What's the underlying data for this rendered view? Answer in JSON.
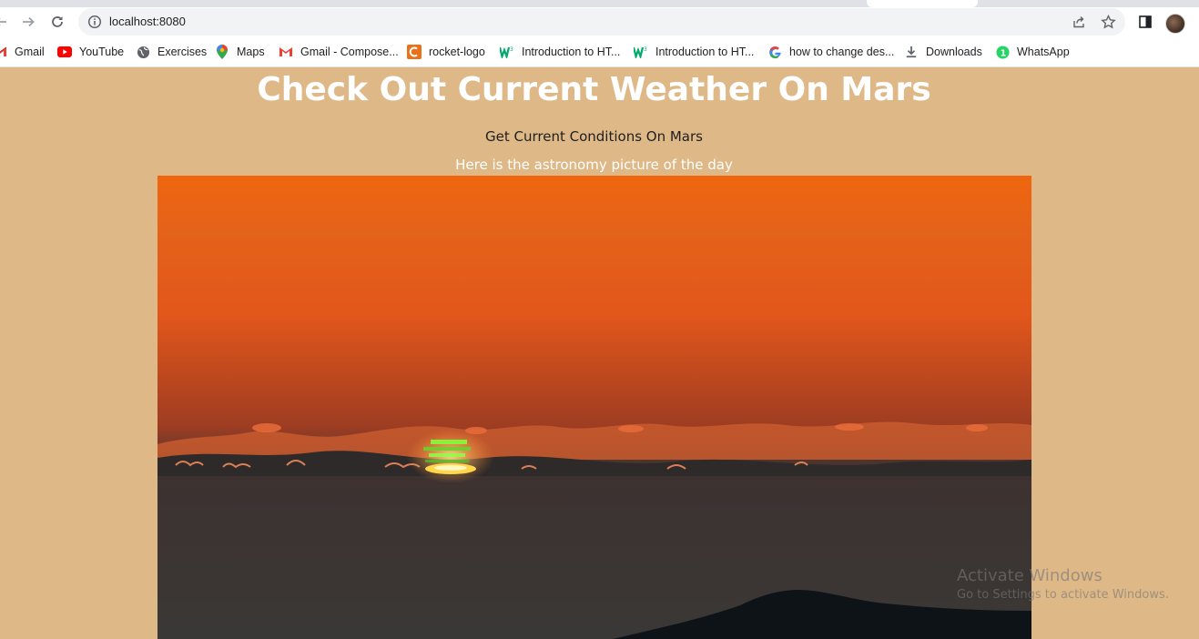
{
  "browser": {
    "url": "localhost:8080",
    "bookmarks": [
      {
        "label": "Gmail",
        "icon": "gmail-icon"
      },
      {
        "label": "YouTube",
        "icon": "youtube-icon"
      },
      {
        "label": "Exercises",
        "icon": "globe-icon"
      },
      {
        "label": "Maps",
        "icon": "maps-pin-icon"
      },
      {
        "label": "Gmail - Compose...",
        "icon": "gmail-icon"
      },
      {
        "label": "rocket-logo",
        "icon": "rocket-logo-icon"
      },
      {
        "label": "Introduction to HT...",
        "icon": "w3schools-icon"
      },
      {
        "label": "Introduction to HT...",
        "icon": "w3schools-icon"
      },
      {
        "label": "how to change des...",
        "icon": "google-icon"
      },
      {
        "label": "Downloads",
        "icon": "download-icon"
      },
      {
        "label": "WhatsApp",
        "icon": "whatsapp-icon"
      }
    ]
  },
  "page": {
    "title": "Check Out Current Weather On Mars",
    "subtitle": "Get Current Conditions On Mars",
    "caption": "Here is the astronomy picture of the day",
    "background_color": "#deb887"
  },
  "watermark": {
    "line1": "Activate Windows",
    "line2": "Go to Settings to activate Windows."
  }
}
